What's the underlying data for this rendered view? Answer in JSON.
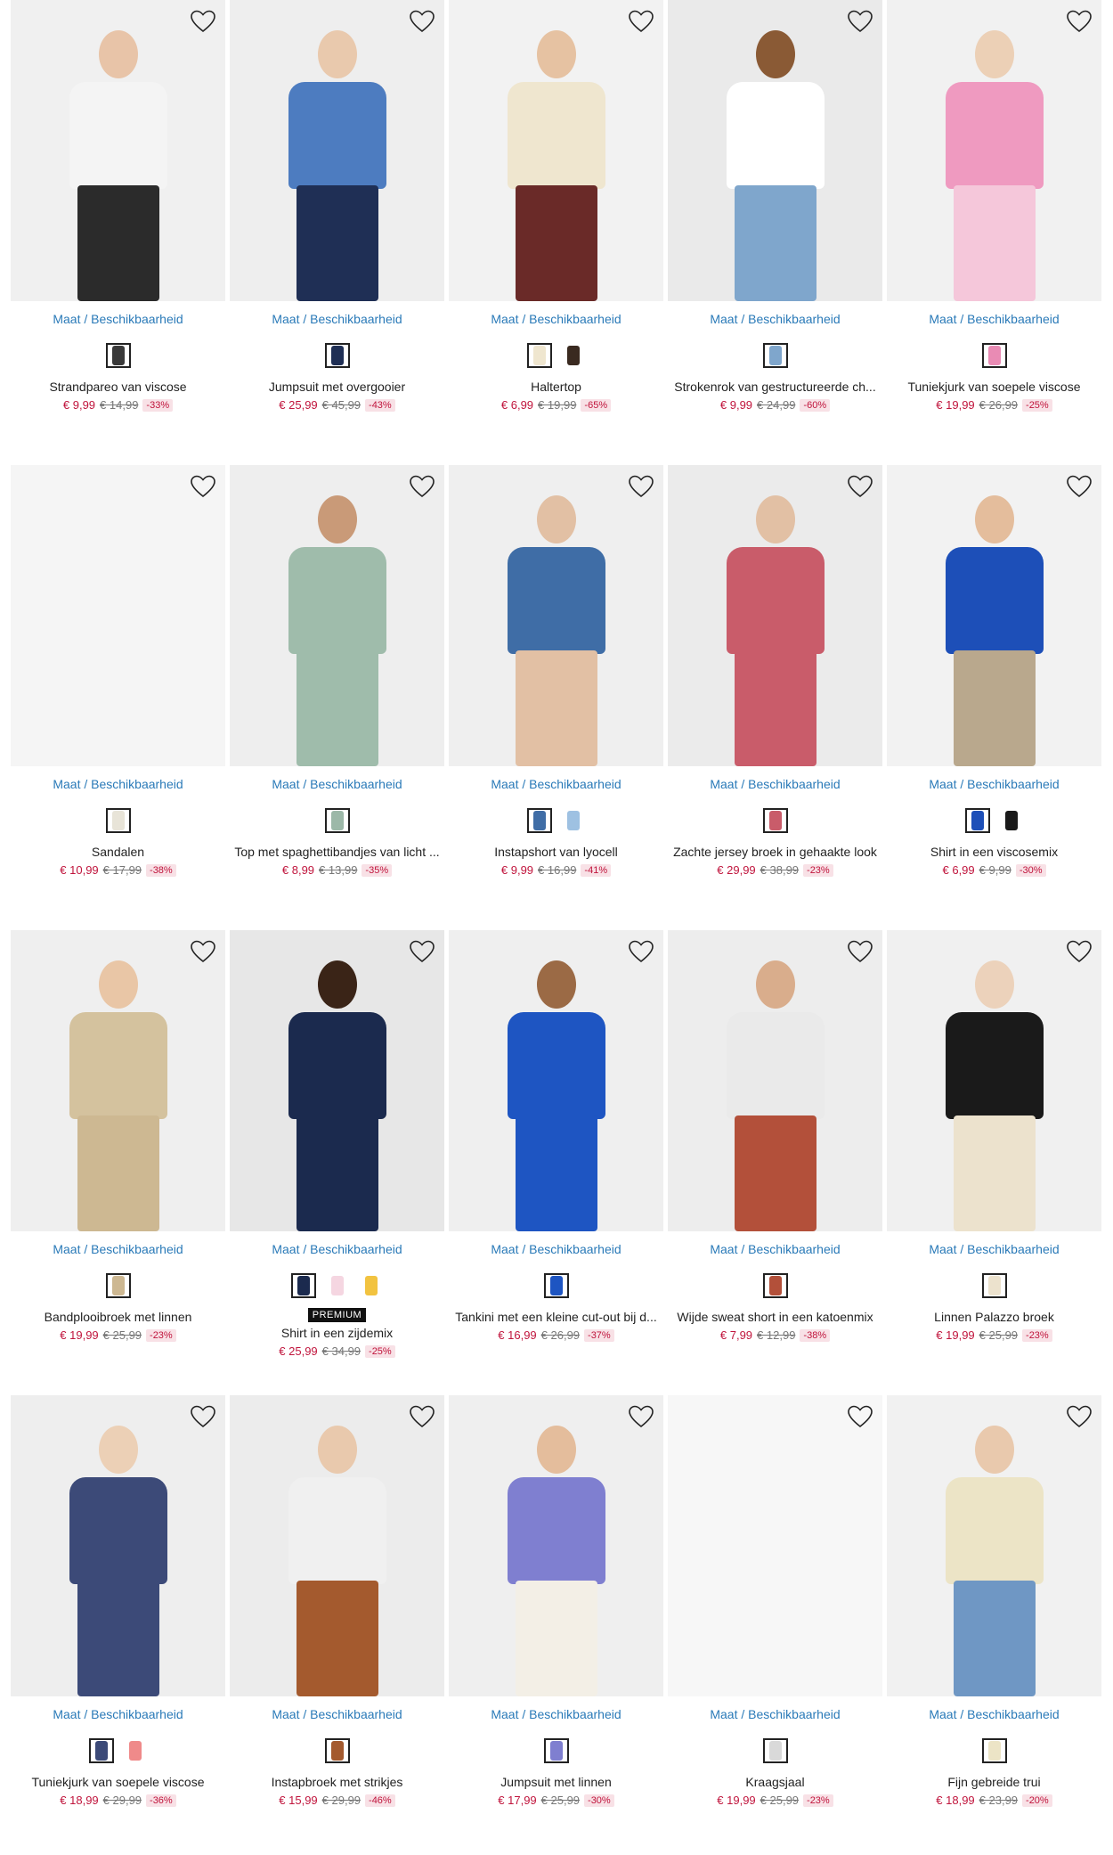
{
  "size_link_label": "Maat / Beschikbaarheid",
  "wishlist_icon": "heart-outline-icon",
  "products": [
    {
      "name": "Strandpareo van viscose",
      "price": "€ 9,99",
      "old_price": "€ 14,99",
      "discount": "-33%",
      "swatches": [
        "#3a3a3a"
      ],
      "bg": "#f0f0f0",
      "top": "#f4f4f4",
      "bottom": "#2b2b2b",
      "skin": "#e8c4a8"
    },
    {
      "name": "Jumpsuit met overgooier",
      "price": "€ 25,99",
      "old_price": "€ 45,99",
      "discount": "-43%",
      "swatches": [
        "#1f2f55"
      ],
      "bg": "#eeeeee",
      "top": "#4d7cc0",
      "bottom": "#1f2f55",
      "skin": "#e9c9ad"
    },
    {
      "name": "Haltertop",
      "price": "€ 6,99",
      "old_price": "€ 19,99",
      "discount": "-65%",
      "swatches": [
        "#efe6cf",
        "#3a2a20"
      ],
      "bg": "#f2f2f2",
      "top": "#efe6cf",
      "bottom": "#6a2a28",
      "skin": "#e6c2a2"
    },
    {
      "name": "Strokenrok van gestructureerde ch...",
      "price": "€ 9,99",
      "old_price": "€ 24,99",
      "discount": "-60%",
      "swatches": [
        "#7fa6cc"
      ],
      "bg": "#eaeaea",
      "top": "#ffffff",
      "bottom": "#7fa6cc",
      "skin": "#8a5a35"
    },
    {
      "name": "Tuniekjurk van soepele viscose",
      "price": "€ 19,99",
      "old_price": "€ 26,99",
      "discount": "-25%",
      "swatches": [
        "#e98bb4"
      ],
      "bg": "#f1f1f1",
      "top": "#ef9ac0",
      "bottom": "#f5c7da",
      "skin": "#ecd0b6"
    },
    {
      "name": "Sandalen",
      "price": "€ 10,99",
      "old_price": "€ 17,99",
      "discount": "-38%",
      "swatches": [
        "#e8e4d8"
      ],
      "bg": "#f5f5f5",
      "top": "#f5f5f5",
      "bottom": "#f5f5f5",
      "skin": "#f5f5f5"
    },
    {
      "name": "Top met spaghettibandjes van licht ...",
      "price": "€ 8,99",
      "old_price": "€ 13,99",
      "discount": "-35%",
      "swatches": [
        "#9cb8a8"
      ],
      "bg": "#eeeeee",
      "top": "#9fbcab",
      "bottom": "#9fbcab",
      "skin": "#c99a78"
    },
    {
      "name": "Instapshort van lyocell",
      "price": "€ 9,99",
      "old_price": "€ 16,99",
      "discount": "-41%",
      "swatches": [
        "#3f6da6",
        "#9ec1e2"
      ],
      "bg": "#efefef",
      "top": "#3f6da6",
      "bottom": "#e2c0a4",
      "skin": "#e2c0a4"
    },
    {
      "name": "Zachte jersey broek in gehaakte look",
      "price": "€ 29,99",
      "old_price": "€ 38,99",
      "discount": "-23%",
      "swatches": [
        "#c95c6a"
      ],
      "bg": "#ebebeb",
      "top": "#c95c6a",
      "bottom": "#c95c6a",
      "skin": "#e2c0a4"
    },
    {
      "name": "Shirt in een viscosemix",
      "price": "€ 6,99",
      "old_price": "€ 9,99",
      "discount": "-30%",
      "swatches": [
        "#1d4fb8",
        "#1a1a1a"
      ],
      "bg": "#f2f2f2",
      "top": "#1d4fb8",
      "bottom": "#b9a88d",
      "skin": "#e4bd9c"
    },
    {
      "name": "Bandplooibroek met linnen",
      "price": "€ 19,99",
      "old_price": "€ 25,99",
      "discount": "-23%",
      "swatches": [
        "#cdb892"
      ],
      "bg": "#efefef",
      "top": "#d4c29e",
      "bottom": "#cdb892",
      "skin": "#e9c6a6"
    },
    {
      "name": "Shirt in een zijdemix",
      "price": "€ 25,99",
      "old_price": "€ 34,99",
      "discount": "-25%",
      "swatches": [
        "#1b2a4e",
        "#f5d6e1",
        "#f2c340"
      ],
      "badge": "PREMIUM",
      "bg": "#e7e7e7",
      "top": "#1b2a4e",
      "bottom": "#1b2a4e",
      "skin": "#3a2417"
    },
    {
      "name": "Tankini met een kleine cut-out bij d...",
      "price": "€ 16,99",
      "old_price": "€ 26,99",
      "discount": "-37%",
      "swatches": [
        "#1e55c2"
      ],
      "bg": "#efefef",
      "top": "#1e55c2",
      "bottom": "#1e55c2",
      "skin": "#9b6a45"
    },
    {
      "name": "Wijde sweat short in een katoenmix",
      "price": "€ 7,99",
      "old_price": "€ 12,99",
      "discount": "-38%",
      "swatches": [
        "#b3503a"
      ],
      "bg": "#ededed",
      "top": "#eaeaea",
      "bottom": "#b3503a",
      "skin": "#d9ad8c"
    },
    {
      "name": "Linnen Palazzo broek",
      "price": "€ 19,99",
      "old_price": "€ 25,99",
      "discount": "-23%",
      "swatches": [
        "#ece2cd"
      ],
      "bg": "#f0f0f0",
      "top": "#1a1a1a",
      "bottom": "#ece2cd",
      "skin": "#ecd2bb"
    },
    {
      "name": "Tuniekjurk van soepele viscose",
      "price": "€ 18,99",
      "old_price": "€ 29,99",
      "discount": "-36%",
      "swatches": [
        "#3c4a78",
        "#ef8a8a"
      ],
      "bg": "#eeeeee",
      "top": "#3c4a78",
      "bottom": "#3c4a78",
      "skin": "#ecd0b6"
    },
    {
      "name": "Instapbroek met strikjes",
      "price": "€ 15,99",
      "old_price": "€ 29,99",
      "discount": "-46%",
      "swatches": [
        "#a45a2e"
      ],
      "bg": "#ececec",
      "top": "#f0f0f0",
      "bottom": "#a45a2e",
      "skin": "#e9c9ad"
    },
    {
      "name": "Jumpsuit met linnen",
      "price": "€ 17,99",
      "old_price": "€ 25,99",
      "discount": "-30%",
      "swatches": [
        "#7f7fd0"
      ],
      "bg": "#efefef",
      "top": "#7f7fd0",
      "bottom": "#f3efe6",
      "skin": "#e4bd9c"
    },
    {
      "name": "Kraagsjaal",
      "price": "€ 19,99",
      "old_price": "€ 25,99",
      "discount": "-23%",
      "swatches": [
        "#d9d9d9"
      ],
      "bg": "#f7f7f7",
      "top": "#f7f7f7",
      "bottom": "#f7f7f7",
      "skin": "#f7f7f7"
    },
    {
      "name": "Fijn gebreide trui",
      "price": "€ 18,99",
      "old_price": "€ 23,99",
      "discount": "-20%",
      "swatches": [
        "#ece4c6"
      ],
      "bg": "#f1f1f1",
      "top": "#ece4c6",
      "bottom": "#6f97c4",
      "skin": "#e9c9ad"
    }
  ]
}
